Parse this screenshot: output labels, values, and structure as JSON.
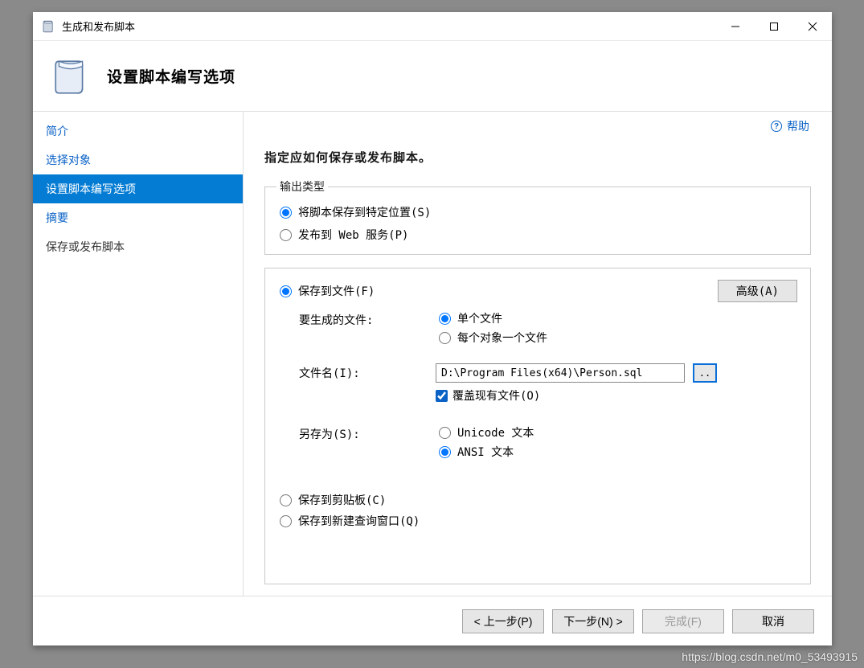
{
  "window": {
    "title": "生成和发布脚本"
  },
  "header": {
    "heading": "设置脚本编写选项"
  },
  "help": {
    "label": "帮助",
    "glyph": "?"
  },
  "sidebar": {
    "items": [
      {
        "label": "简介",
        "kind": "link"
      },
      {
        "label": "选择对象",
        "kind": "link"
      },
      {
        "label": "设置脚本编写选项",
        "kind": "selected"
      },
      {
        "label": "摘要",
        "kind": "link"
      },
      {
        "label": "保存或发布脚本",
        "kind": "plain"
      }
    ]
  },
  "content": {
    "instruction": "指定应如何保存或发布脚本。",
    "output_type": {
      "legend": "输出类型",
      "opt_save": "将脚本保存到特定位置(S)",
      "opt_publish": "发布到 Web 服务(P)",
      "selected": "save"
    },
    "details": {
      "save_to_file": "保存到文件(F)",
      "advanced_btn": "高级(A)",
      "files_label": "要生成的文件:",
      "files_single": "单个文件",
      "files_per_object": "每个对象一个文件",
      "files_selected": "single",
      "filename_label": "文件名(I):",
      "filename_value": "D:\\Program Files(x64)\\Person.sql",
      "browse": "..",
      "overwrite": "覆盖现有文件(O)",
      "overwrite_checked": true,
      "save_as_label": "另存为(S):",
      "save_as_unicode": "Unicode 文本",
      "save_as_ansi": "ANSI 文本",
      "save_as_selected": "ansi",
      "clipboard": "保存到剪贴板(C)",
      "new_query": "保存到新建查询窗口(Q)",
      "dest_selected": "file"
    }
  },
  "footer": {
    "prev": "< 上一步(P)",
    "next": "下一步(N) >",
    "finish": "完成(F)",
    "cancel": "取消"
  },
  "watermark": "https://blog.csdn.net/m0_53493915"
}
